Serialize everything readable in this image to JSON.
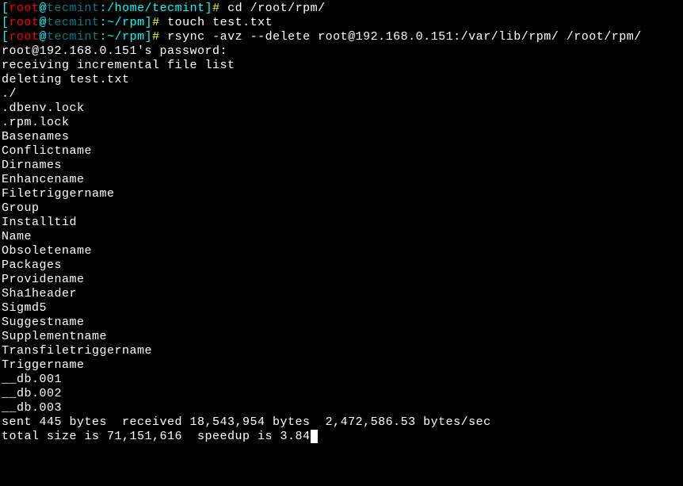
{
  "line1": {
    "bracket_open": "[",
    "user": "root",
    "at": "@",
    "host": "tecmint",
    "colon": ":",
    "path": "/home/tecmint",
    "bracket_close": "]",
    "prompt": "#",
    "command": " cd /root/rpm/"
  },
  "line2": {
    "bracket_open": "[",
    "user": "root",
    "at": "@",
    "host": "tecmint",
    "colon": ":",
    "path": "~/rpm",
    "bracket_close": "]",
    "prompt": "#",
    "command": " touch test.txt"
  },
  "line3": {
    "bracket_open": "[",
    "user": "root",
    "at": "@",
    "host": "tecmint",
    "colon": ":",
    "path": "~/rpm",
    "bracket_close": "]",
    "prompt": "#",
    "command": " rsync -avz --delete root@192.168.0.151:/var/lib/rpm/ /root/rpm/"
  },
  "output": {
    "password_prompt": "root@192.168.0.151's password:",
    "receiving": "receiving incremental file list",
    "deleting": "deleting test.txt",
    "dotslash": "./",
    "files": [
      ".dbenv.lock",
      ".rpm.lock",
      "Basenames",
      "Conflictname",
      "Dirnames",
      "Enhancename",
      "Filetriggername",
      "Group",
      "Installtid",
      "Name",
      "Obsoletename",
      "Packages",
      "Providename",
      "Sha1header",
      "Sigmd5",
      "Suggestname",
      "Supplementname",
      "Transfiletriggername",
      "Triggername",
      "__db.001",
      "__db.002",
      "__db.003"
    ],
    "blank": "",
    "sent": "sent 445 bytes  received 18,543,954 bytes  2,472,586.53 bytes/sec",
    "total": "total size is 71,151,616  speedup is 3.84"
  }
}
